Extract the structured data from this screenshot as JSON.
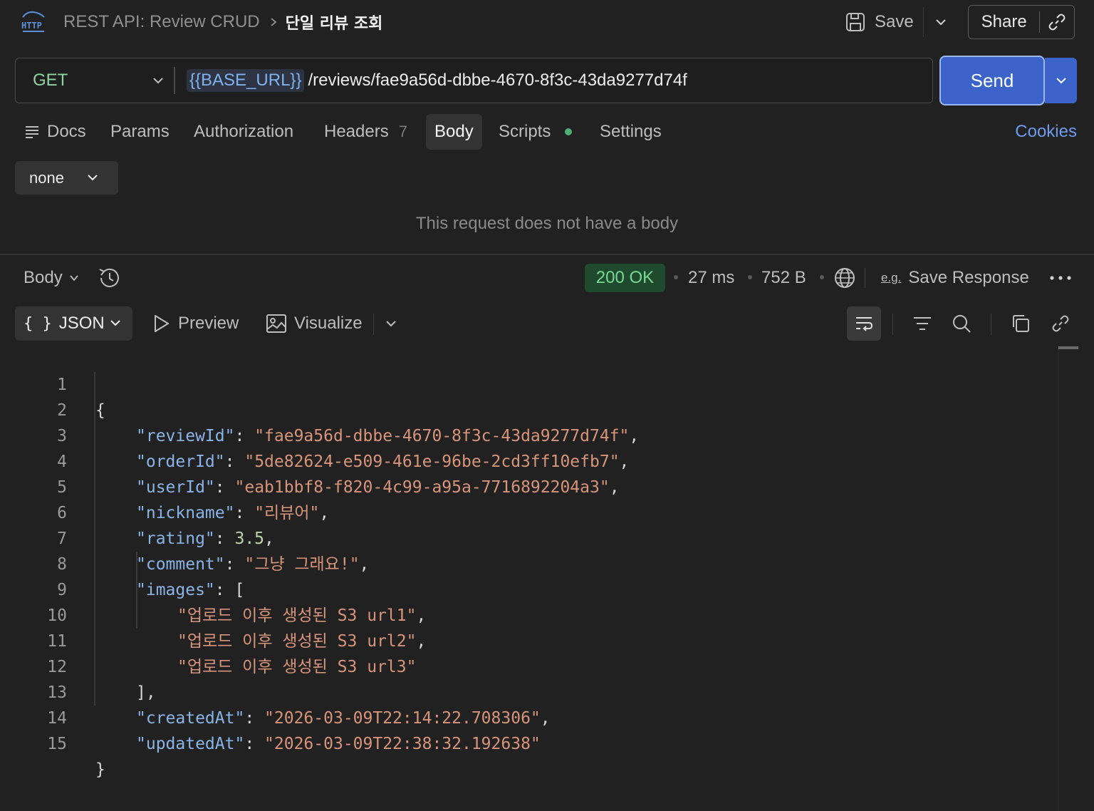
{
  "header": {
    "http_icon": "http-icon",
    "collection": "REST API: Review CRUD",
    "request_name": "단일 리뷰 조회",
    "save_label": "Save",
    "share_label": "Share"
  },
  "request": {
    "method": "GET",
    "url_variable": "{{BASE_URL}}",
    "url_path": "/reviews/fae9a56d-dbbe-4670-8f3c-43da9277d74f",
    "send_label": "Send"
  },
  "tabs": [
    {
      "label": "Docs"
    },
    {
      "label": "Params"
    },
    {
      "label": "Authorization"
    },
    {
      "label": "Headers",
      "count": "7"
    },
    {
      "label": "Body",
      "active": true
    },
    {
      "label": "Scripts",
      "has_dot": true
    },
    {
      "label": "Settings"
    }
  ],
  "cookies_label": "Cookies",
  "body_editor": {
    "type": "none",
    "empty_message": "This request does not have a body"
  },
  "response": {
    "view_label": "Body",
    "status": "200 OK",
    "time": "27 ms",
    "size": "752 B",
    "eg_label": "e.g.",
    "save_response_label": "Save Response",
    "format": "JSON",
    "preview_label": "Preview",
    "visualize_label": "Visualize",
    "line_numbers": [
      "1",
      "2",
      "3",
      "4",
      "5",
      "6",
      "7",
      "8",
      "9",
      "10",
      "11",
      "12",
      "13",
      "14",
      "15"
    ],
    "json": {
      "reviewId": "fae9a56d-dbbe-4670-8f3c-43da9277d74f",
      "orderId": "5de82624-e509-461e-96be-2cd3ff10efb7",
      "userId": "eab1bbf8-f820-4c99-a95a-7716892204a3",
      "nickname": "리뷰어",
      "rating": "3.5",
      "comment": "그냥 그래요!",
      "images": [
        "업로드 이후 생성된 S3 url1",
        "업로드 이후 생성된 S3 url2",
        "업로드 이후 생성된 S3 url3"
      ],
      "createdAt": "2026-03-09T22:14:22.708306",
      "updatedAt": "2026-03-09T22:38:32.192638"
    }
  },
  "colors": {
    "accent": "#3b63c9",
    "status_ok": "#78d893",
    "method_get": "#8fd3a0",
    "link": "#6d9bf0"
  }
}
